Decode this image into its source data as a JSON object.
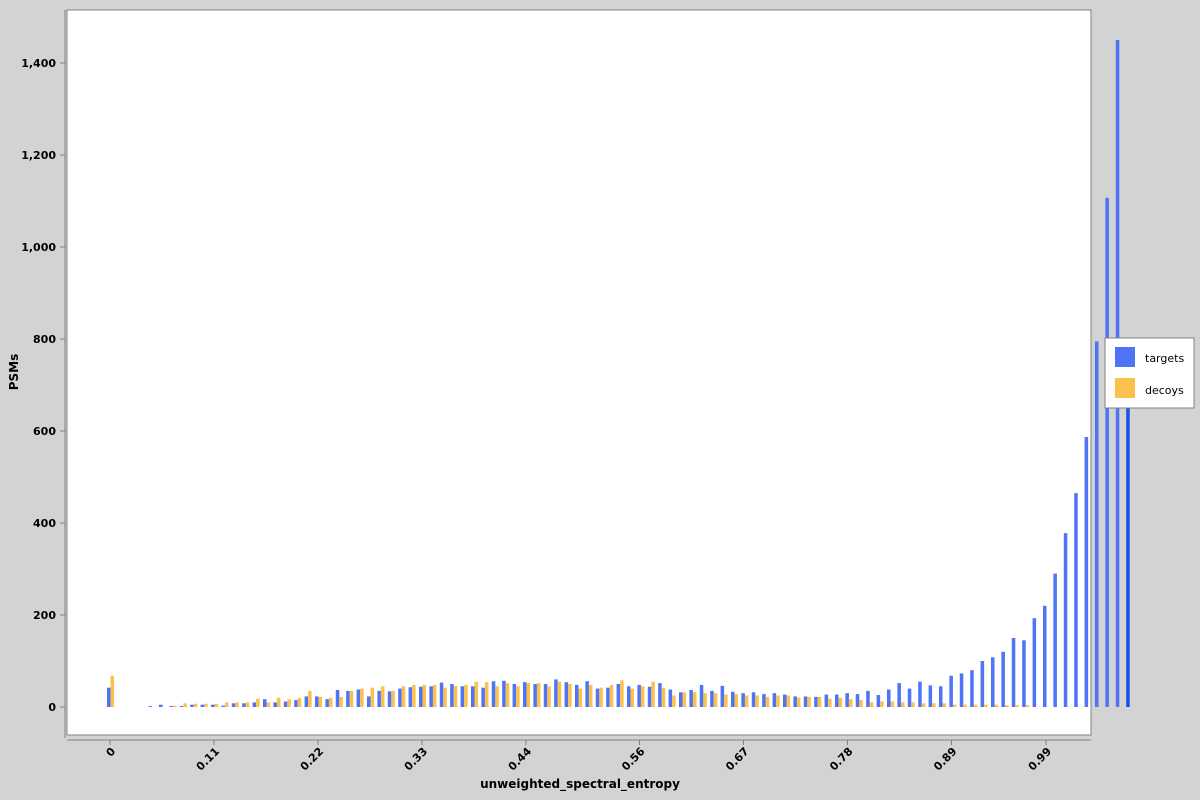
{
  "chart_data": {
    "type": "bar",
    "title": "",
    "xlabel": "unweighted_spectral_entropy",
    "ylabel": "PSMs",
    "x_tick_labels": [
      "0",
      "0.11",
      "0.22",
      "0.33",
      "0.44",
      "0.56",
      "0.67",
      "0.78",
      "0.89",
      "0.99"
    ],
    "x_tick_values": [
      0,
      0.11,
      0.22,
      0.33,
      0.44,
      0.56,
      0.67,
      0.78,
      0.89,
      0.99
    ],
    "y_tick_labels": [
      "0",
      "200",
      "400",
      "600",
      "800",
      "1,000",
      "1,200",
      "1,400"
    ],
    "y_tick_values": [
      0,
      200,
      400,
      600,
      800,
      1000,
      1200,
      1400
    ],
    "ylim": [
      0,
      1450
    ],
    "xlim": [
      0,
      0.99
    ],
    "grid": false,
    "legend_position": "right",
    "colors": {
      "targets": "#4f74f5",
      "targets_last": "#1f4fe8",
      "decoys": "#fbc14d",
      "plot_bg": "#ffffff",
      "page_bg": "#d3d3d3"
    },
    "bin_width": 0.011,
    "bin_start": 0.0,
    "series": [
      {
        "name": "targets",
        "values": [
          42,
          0,
          0,
          0,
          2,
          5,
          2,
          2,
          5,
          5,
          5,
          3,
          8,
          8,
          10,
          17,
          10,
          12,
          15,
          23,
          23,
          17,
          37,
          35,
          38,
          23,
          35,
          34,
          40,
          43,
          44,
          45,
          53,
          50,
          45,
          45,
          42,
          56,
          57,
          50,
          54,
          50,
          50,
          60,
          54,
          48,
          56,
          40,
          42,
          50,
          45,
          48,
          44,
          52,
          38,
          32,
          37,
          48,
          35,
          46,
          33,
          30,
          32,
          28,
          30,
          27,
          23,
          23,
          22,
          27,
          27,
          30,
          28,
          35,
          26,
          38,
          52,
          40,
          55,
          47,
          45,
          68,
          73,
          80,
          100,
          108,
          120,
          150,
          145,
          193,
          220,
          290,
          378,
          465,
          587,
          795,
          1107,
          1450,
          680
        ],
        "last_bar_darker": true
      },
      {
        "name": "decoys",
        "values": [
          68,
          0,
          0,
          0,
          0,
          0,
          3,
          8,
          7,
          7,
          7,
          10,
          10,
          10,
          18,
          10,
          20,
          17,
          20,
          35,
          22,
          20,
          22,
          35,
          40,
          42,
          45,
          35,
          45,
          48,
          48,
          48,
          42,
          46,
          48,
          55,
          54,
          45,
          52,
          45,
          52,
          52,
          45,
          55,
          50,
          40,
          48,
          42,
          48,
          58,
          40,
          45,
          55,
          42,
          25,
          32,
          32,
          30,
          30,
          27,
          28,
          25,
          25,
          22,
          25,
          25,
          20,
          22,
          22,
          18,
          20,
          17,
          15,
          10,
          12,
          12,
          10,
          10,
          8,
          8,
          8,
          5,
          5,
          5,
          5,
          5,
          4,
          4,
          4,
          0,
          0,
          0,
          0,
          0,
          0,
          0,
          0,
          0,
          0
        ]
      }
    ]
  }
}
